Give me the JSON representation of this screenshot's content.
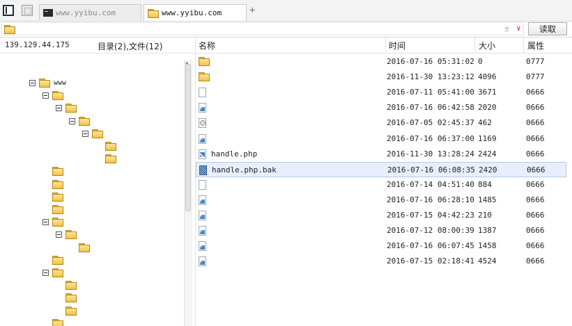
{
  "tabs": [
    {
      "label": "www.yyibu.com",
      "active": false,
      "icon": "terminal-icon"
    },
    {
      "label": "www.yyibu.com",
      "active": true,
      "icon": "folder-icon"
    }
  ],
  "address": {
    "value": "",
    "clear_icon": "±",
    "dropdown_icon": "∨",
    "read_button": "读取"
  },
  "left": {
    "server_ip": "139.129.44.175",
    "summary": "目录(2),文件(12)",
    "tree": [
      {
        "label": "www",
        "level": 0,
        "expanded": true
      },
      {
        "label": "",
        "level": 1,
        "expanded": true
      },
      {
        "label": "",
        "level": 2,
        "expanded": true
      },
      {
        "label": "",
        "level": 3,
        "expanded": true
      },
      {
        "label": "",
        "level": 4,
        "expanded": true
      },
      {
        "label": "",
        "level": 5,
        "expanded": false
      },
      {
        "label": "",
        "level": 5,
        "expanded": false
      },
      {
        "label": "",
        "level": 1,
        "expanded": false
      },
      {
        "label": "",
        "level": 1,
        "expanded": false
      },
      {
        "label": "",
        "level": 1,
        "expanded": false
      },
      {
        "label": "",
        "level": 1,
        "expanded": false
      },
      {
        "label": "",
        "level": 1,
        "expanded": true
      },
      {
        "label": "",
        "level": 2,
        "expanded": true
      },
      {
        "label": "",
        "level": 3,
        "expanded": false
      },
      {
        "label": "",
        "level": 1,
        "expanded": false
      },
      {
        "label": "",
        "level": 1,
        "expanded": true
      },
      {
        "label": "",
        "level": 2,
        "expanded": false
      },
      {
        "label": "",
        "level": 2,
        "expanded": false
      },
      {
        "label": "",
        "level": 2,
        "expanded": false
      },
      {
        "label": "",
        "level": 1,
        "expanded": false
      },
      {
        "label": "",
        "level": 1,
        "expanded": false
      }
    ]
  },
  "files": {
    "columns": {
      "name": "名称",
      "time": "时间",
      "size": "大小",
      "attr": "属性"
    },
    "rows": [
      {
        "name": "",
        "type": "folder",
        "time": "2016-07-16 05:31:02",
        "size": "0",
        "attr": "0777",
        "selected": false
      },
      {
        "name": "",
        "type": "folder",
        "time": "2016-11-30 13:23:12",
        "size": "4096",
        "attr": "0777",
        "selected": false
      },
      {
        "name": "",
        "type": "blank",
        "time": "2016-07-11 05:41:00",
        "size": "3671",
        "attr": "0666",
        "selected": false
      },
      {
        "name": "",
        "type": "image",
        "time": "2016-07-16 06:42:58",
        "size": "2020",
        "attr": "0666",
        "selected": false
      },
      {
        "name": "",
        "type": "gear",
        "time": "2016-07-05 02:45:37",
        "size": "462",
        "attr": "0666",
        "selected": false
      },
      {
        "name": "",
        "type": "image",
        "time": "2016-07-16 06:37:00",
        "size": "1169",
        "attr": "0666",
        "selected": false
      },
      {
        "name": "handle.php",
        "type": "php",
        "time": "2016-11-30 13:28:24",
        "size": "2424",
        "attr": "0666",
        "selected": false
      },
      {
        "name": "handle.php.bak",
        "type": "bak",
        "time": "2016-07-16 06:08:35",
        "size": "2420",
        "attr": "0666",
        "selected": true
      },
      {
        "name": "",
        "type": "blank",
        "time": "2016-07-14 04:51:40",
        "size": "884",
        "attr": "0666",
        "selected": false
      },
      {
        "name": "",
        "type": "image",
        "time": "2016-07-16 06:28:10",
        "size": "1485",
        "attr": "0666",
        "selected": false
      },
      {
        "name": "",
        "type": "image",
        "time": "2016-07-15 04:42:23",
        "size": "210",
        "attr": "0666",
        "selected": false
      },
      {
        "name": "",
        "type": "image",
        "time": "2016-07-12 08:00:39",
        "size": "1387",
        "attr": "0666",
        "selected": false
      },
      {
        "name": "",
        "type": "image",
        "time": "2016-07-16 06:07:45",
        "size": "1458",
        "attr": "0666",
        "selected": false
      },
      {
        "name": "",
        "type": "image",
        "time": "2016-07-15 02:18:41",
        "size": "4524",
        "attr": "0666",
        "selected": false
      }
    ]
  }
}
